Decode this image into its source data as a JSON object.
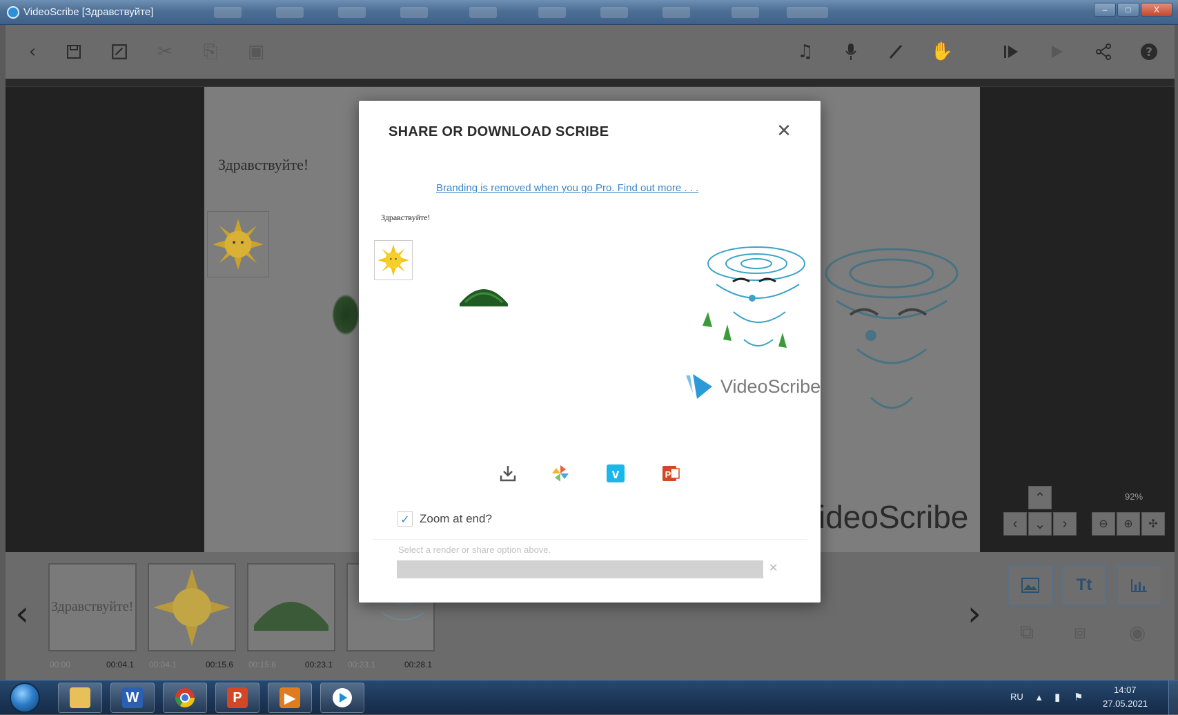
{
  "window": {
    "title": "VideoScribe [Здравствуйте]",
    "buttons": {
      "minimize": "–",
      "maximize": "□",
      "close": "X"
    }
  },
  "toolbar": {
    "left_icons": [
      "back-icon",
      "save-icon",
      "save-as-icon",
      "cut-icon",
      "copy-icon",
      "paste-icon"
    ],
    "right_icons": [
      "music-icon",
      "microphone-icon",
      "pen-icon",
      "hand-icon",
      "play-from-icon",
      "play-icon",
      "share-icon",
      "help-icon"
    ]
  },
  "canvas": {
    "text": "Здравствуйте!",
    "brand": "ideoScribe",
    "zoom_level": "92%"
  },
  "timeline": {
    "thumbnails": [
      {
        "label": "Здравствуйте!",
        "start": "00:00",
        "end": "00:04.1"
      },
      {
        "label": "",
        "start": "00:04.1",
        "end": "00:15.6"
      },
      {
        "label": "",
        "start": "00:15.6",
        "end": "00:23.1"
      },
      {
        "label": "",
        "start": "00:23.1",
        "end": "00:28.1"
      }
    ],
    "tools": {
      "image": "image-icon",
      "text": "Tt",
      "chart": "chart-icon"
    }
  },
  "modal": {
    "title": "SHARE OR DOWNLOAD SCRIBE",
    "promo_link": "Branding is removed when you go Pro. Find out more . . .",
    "preview_text": "Здравствуйте!",
    "preview_brand": "VideoScribe",
    "share_options": [
      "download-icon",
      "pinwheel-icon",
      "vimeo-icon",
      "powerpoint-icon"
    ],
    "zoom_at_end_label": "Zoom at end?",
    "zoom_at_end_checked": true,
    "hint": "Select a render or share option above.",
    "progress": 0,
    "accent_color": "#3d86c6"
  },
  "taskbar": {
    "apps": [
      "explorer-icon",
      "word-icon",
      "chrome-icon",
      "powerpoint-icon",
      "media-player-icon",
      "videoscribe-icon"
    ],
    "word_glyph": "W",
    "language": "RU",
    "time": "14:07",
    "date": "27.05.2021"
  }
}
